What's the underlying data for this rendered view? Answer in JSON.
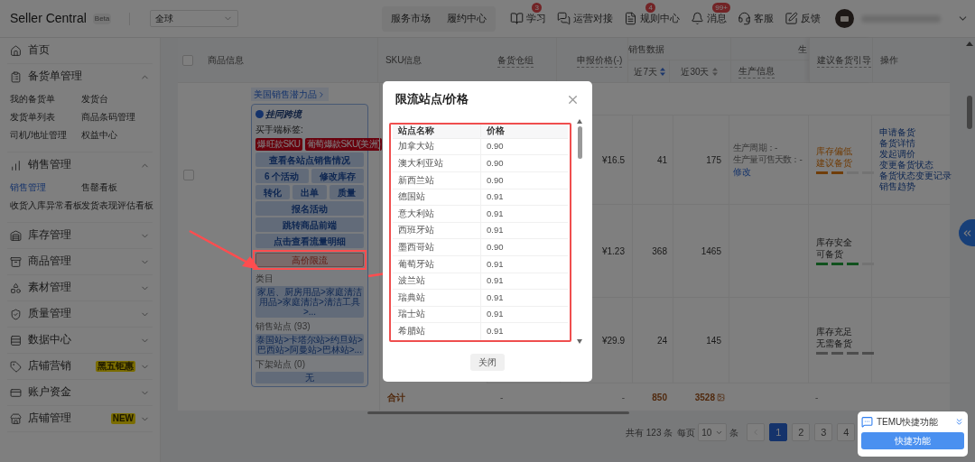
{
  "header": {
    "brand": "Seller Central",
    "beta": "Beta",
    "region": "全球",
    "nav": [
      "服务市场",
      "履约中心"
    ],
    "tools": [
      {
        "label": "学习",
        "badge": "3"
      },
      {
        "label": "运营对接"
      },
      {
        "label": "规则中心",
        "badge": "4"
      },
      {
        "label": "消息",
        "badge": "99+"
      },
      {
        "label": "客服"
      },
      {
        "label": "反馈"
      }
    ]
  },
  "sidebar": {
    "items": [
      {
        "label": "首页"
      },
      {
        "label": "备货单管理",
        "expanded": true,
        "children": [
          {
            "label": "我的备货单",
            "selected": false
          },
          {
            "label": "发货台",
            "selected": false
          },
          {
            "label": "发货单列表",
            "selected": false
          },
          {
            "label": "商品条码管理",
            "selected": false
          },
          {
            "label": "司机/地址管理",
            "selected": false
          },
          {
            "label": "权益中心",
            "selected": false
          }
        ]
      },
      {
        "label": "销售管理",
        "expanded": true,
        "children": [
          {
            "label": "销售管理",
            "selected": true
          },
          {
            "label": "售罄看板",
            "selected": false
          },
          {
            "label": "收货入库异常看板",
            "selected": false
          },
          {
            "label": "发货表现评估看板",
            "selected": false
          }
        ]
      },
      {
        "label": "库存管理",
        "expanded": false
      },
      {
        "label": "商品管理",
        "expanded": false
      },
      {
        "label": "素材管理",
        "expanded": false
      },
      {
        "label": "质量管理",
        "expanded": false
      },
      {
        "label": "数据中心",
        "expanded": false
      },
      {
        "label": "店铺营销",
        "expanded": false,
        "badge": "黑五钜惠"
      },
      {
        "label": "账户资金",
        "expanded": false
      },
      {
        "label": "店铺管理",
        "expanded": false,
        "badge": "NEW"
      }
    ]
  },
  "table": {
    "select_all": {
      "checked": false
    },
    "headers": {
      "product": "商品信息",
      "sku": "SKU信息",
      "warehouse": "备货仓组",
      "price": "申报价格(-)",
      "sales_group": "销售数据",
      "last_7_days": {
        "label": "近7天",
        "sorted": true
      },
      "last_30_days": {
        "label": "近30天",
        "sorted": false
      },
      "production_group": "生",
      "production": "生产信息",
      "guide": "建议备货引导",
      "actions": "操作"
    },
    "product": {
      "checked": false,
      "tag_link": "美国销售潜力品",
      "brand": "挂同跨境",
      "buyer_tags_label": "买手端标签:",
      "buyer_tags": [
        "爆旺款SKU",
        "葡萄爆款SKU(美洲)"
      ],
      "button_rows": [
        [
          "查看各站点销售情况"
        ],
        [
          "6 个活动",
          "修改库存"
        ],
        [
          "转化",
          "出单",
          "质量"
        ],
        [
          "报名活动"
        ],
        [
          "跳转商品前端"
        ],
        [
          "点击查看流量明细"
        ]
      ],
      "limit_button": "高价限流",
      "sections": [
        {
          "label": "类目",
          "value": "家居、厨房用品>家庭清洁用品>家庭清洁>清洁工具>..."
        },
        {
          "label": "销售站点 (93)",
          "value": "泰国站>卡塔尔站>约旦站>巴西站>阿曼站>巴林站>..."
        },
        {
          "label": "下架站点 (0)",
          "value": "无"
        }
      ]
    },
    "rows": [
      {
        "price": "¥16.5",
        "last_7_days": "41",
        "last_30_days": "175",
        "production": [
          "生产周期：-",
          "生产量可售天数：-"
        ],
        "production_link": "修改",
        "guide": [
          "库存偏低",
          "建议备货"
        ],
        "warning": true,
        "kind": "low",
        "level": 0.5,
        "actions": [
          "申请备货",
          "备货详情",
          "发起调价",
          "变更备货状态",
          "备货状态变更记录",
          "销售趋势"
        ]
      },
      {
        "price": "¥1.23",
        "last_7_days": "368",
        "last_30_days": "1465",
        "guide": [
          "库存安全",
          "可备货"
        ],
        "warning": false,
        "kind": "safe",
        "level": 0.75
      },
      {
        "price": "¥29.9",
        "last_7_days": "24",
        "last_30_days": "145",
        "guide": [
          "库存充足",
          "无需备货"
        ],
        "warning": false,
        "kind": "ample",
        "level": 1
      }
    ],
    "total": {
      "label": "合计",
      "warehouse": "-",
      "price": "-",
      "last_7_days": "850",
      "last_30_days": "3528",
      "guide": "-"
    }
  },
  "pagination": {
    "total": "共有 123 条",
    "per_page_label": "每页",
    "per_page": "10",
    "unit": "条",
    "pages": [
      {
        "label": "1",
        "selected": true
      },
      {
        "label": "2",
        "selected": false
      },
      {
        "label": "3",
        "selected": false
      },
      {
        "label": "4",
        "selected": false
      }
    ]
  },
  "modal": {
    "title": "限流站点/价格",
    "columns": [
      "站点名称",
      "价格"
    ],
    "rows": [
      [
        "加拿大站",
        "0.90"
      ],
      [
        "澳大利亚站",
        "0.90"
      ],
      [
        "新西兰站",
        "0.90"
      ],
      [
        "德国站",
        "0.91"
      ],
      [
        "意大利站",
        "0.91"
      ],
      [
        "西班牙站",
        "0.91"
      ],
      [
        "墨西哥站",
        "0.90"
      ],
      [
        "葡萄牙站",
        "0.91"
      ],
      [
        "波兰站",
        "0.91"
      ],
      [
        "瑞典站",
        "0.91"
      ],
      [
        "瑞士站",
        "0.91"
      ],
      [
        "希腊站",
        "0.91"
      ]
    ],
    "close_button": "关闭"
  },
  "widget": {
    "title": "TEMU快捷功能",
    "button": "快捷功能"
  }
}
